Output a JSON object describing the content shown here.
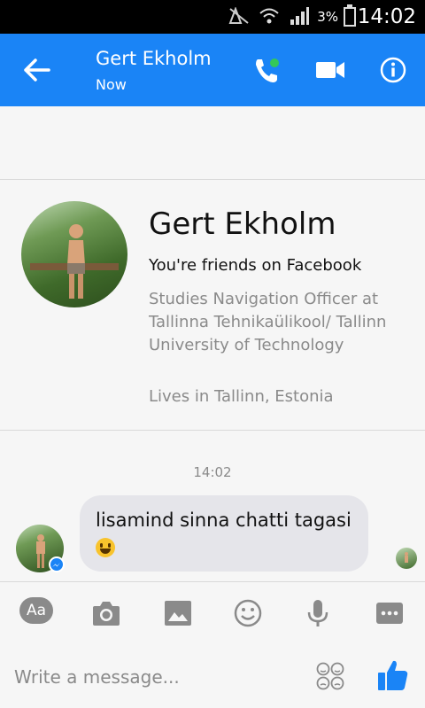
{
  "status_bar": {
    "battery": "3%",
    "time": "14:02"
  },
  "header": {
    "contact_name": "Gert Ekholm",
    "presence": "Now"
  },
  "profile": {
    "name": "Gert Ekholm",
    "friends_text": "You're friends on Facebook",
    "studies": "Studies Navigation Officer at Tallinna Tehnikaülikool/ Tallinn University of Technology",
    "lives": "Lives in Tallinn, Estonia"
  },
  "conversation": {
    "timestamp": "14:02",
    "messages": [
      {
        "text": "lisamind sinna chatti tagasi"
      }
    ]
  },
  "toolbar": {
    "aa_label": "Aa"
  },
  "composer": {
    "placeholder": "Write a message..."
  },
  "colors": {
    "accent": "#1a84f6",
    "bubble": "#e5e5ea",
    "muted_text": "#8a8a8a"
  },
  "icons": [
    "back-arrow-icon",
    "phone-icon",
    "video-camera-icon",
    "info-icon",
    "camera-icon",
    "gallery-icon",
    "emoji-icon",
    "microphone-icon",
    "more-icon",
    "sticker-icon",
    "thumbs-up-icon",
    "messenger-icon",
    "smiley-emoji-icon"
  ]
}
